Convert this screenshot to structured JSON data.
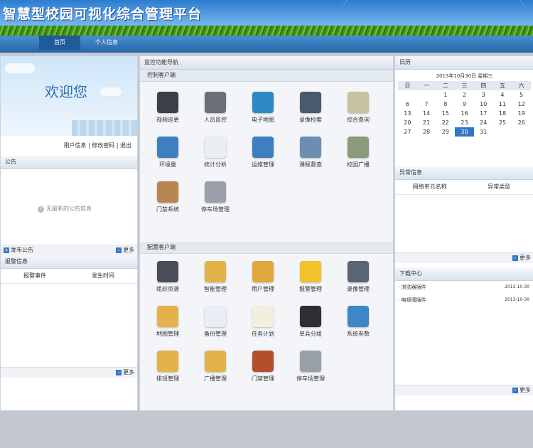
{
  "header": {
    "title": "智慧型校园可视化综合管理平台"
  },
  "nav": {
    "home": "首页",
    "personal": "个人信息"
  },
  "left": {
    "welcome": "欢迎您",
    "user_links": "用户信息 | 修改密码 | 退出",
    "notice_title": "公告",
    "notice_empty": "无最新的公告信息",
    "publish": "发布公告",
    "more": "更多",
    "alarm_title": "报警信息",
    "alarm_cols": [
      "报警事件",
      "发生时间"
    ],
    "more2": "更多"
  },
  "middle": {
    "title": "监控功能导航",
    "client_head": "控制客户端",
    "client_items": [
      {
        "label": "视频巡更",
        "icon": "webcam-icon",
        "color": "#3b3f46"
      },
      {
        "label": "人员监控",
        "icon": "person-camera-icon",
        "color": "#6a6f78"
      },
      {
        "label": "电子地图",
        "icon": "globe-icon",
        "color": "#2e8ac6"
      },
      {
        "label": "录像检索",
        "icon": "film-reel-icon",
        "color": "#4a5a6e"
      },
      {
        "label": "综合查询",
        "icon": "document-icon",
        "color": "#c9c2a0"
      },
      {
        "label": "环境量",
        "icon": "monitor-chart-icon",
        "color": "#3d7fc0"
      },
      {
        "label": "统计分析",
        "icon": "document-chart-icon",
        "color": "#e8eef4"
      },
      {
        "label": "运维管理",
        "icon": "network-icon",
        "color": "#3d7fc0"
      },
      {
        "label": "课程督查",
        "icon": "classroom-icon",
        "color": "#6b8fb2"
      },
      {
        "label": "校园广播",
        "icon": "speaker-icon",
        "color": "#8a9a7a"
      },
      {
        "label": "门禁系统",
        "icon": "access-control-icon",
        "color": "#b8874f"
      },
      {
        "label": "停车场管理",
        "icon": "parking-icon",
        "color": "#9aa0a8"
      }
    ],
    "config_head": "配置客户端",
    "config_items": [
      {
        "label": "组织资源",
        "icon": "server-icon",
        "color": "#4a4f57"
      },
      {
        "label": "智能管理",
        "icon": "folder-search-icon",
        "color": "#e3b34a"
      },
      {
        "label": "用户管理",
        "icon": "user-icon",
        "color": "#e0a83b"
      },
      {
        "label": "报警管理",
        "icon": "warning-icon",
        "color": "#f2c22c"
      },
      {
        "label": "录像管理",
        "icon": "video-camera-icon",
        "color": "#5a6472"
      },
      {
        "label": "地图管理",
        "icon": "folder-globe-icon",
        "color": "#e3b34a"
      },
      {
        "label": "备份管理",
        "icon": "backup-icon",
        "color": "#e8eef4"
      },
      {
        "label": "任务计划",
        "icon": "task-list-icon",
        "color": "#f3efe0"
      },
      {
        "label": "单兵分组",
        "icon": "walkie-talkie-icon",
        "color": "#2e2f33"
      },
      {
        "label": "系统参数",
        "icon": "system-settings-icon",
        "color": "#3f86c8"
      },
      {
        "label": "排班管理",
        "icon": "folder-schedule-icon",
        "color": "#e3b34a"
      },
      {
        "label": "广播管理",
        "icon": "folder-broadcast-icon",
        "color": "#e3b34a"
      },
      {
        "label": "门禁管理",
        "icon": "door-icon",
        "color": "#b34f2c"
      },
      {
        "label": "停车场管理",
        "icon": "parking-manage-icon",
        "color": "#9aa0a8"
      }
    ]
  },
  "right": {
    "date_title": "日历",
    "calendar_title": "2013年10月30日 星期三",
    "weekdays": [
      "日",
      "一",
      "二",
      "三",
      "四",
      "五",
      "六"
    ],
    "weeks": [
      [
        "",
        "",
        "1",
        "2",
        "3",
        "4",
        "5"
      ],
      [
        "6",
        "7",
        "8",
        "9",
        "10",
        "11",
        "12"
      ],
      [
        "13",
        "14",
        "15",
        "16",
        "17",
        "18",
        "19"
      ],
      [
        "20",
        "21",
        "22",
        "23",
        "24",
        "25",
        "26"
      ],
      [
        "27",
        "28",
        "29",
        "30",
        "31",
        "",
        ""
      ]
    ],
    "selected_day": "30",
    "exception_title": "异常信息",
    "exception_cols": [
      "网络单元名称",
      "异常类型"
    ],
    "more": "更多",
    "download_title": "下载中心",
    "downloads": [
      {
        "name": "· 浏览器插件",
        "date": "2013-10-30"
      },
      {
        "name": "· 电视墙插件",
        "date": "2013-10-30"
      }
    ],
    "more2": "更多"
  }
}
